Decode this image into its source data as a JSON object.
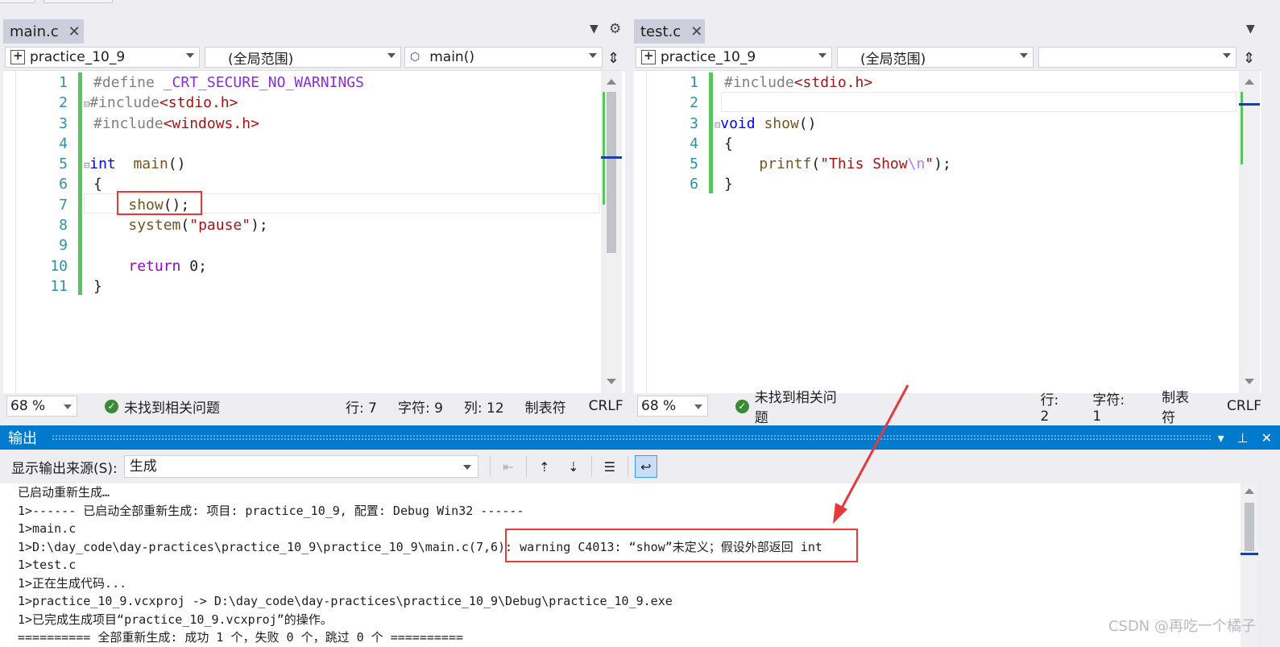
{
  "left_editor": {
    "tab": {
      "label": "main.c",
      "close": "✕"
    },
    "nav": {
      "project": "practice_10_9",
      "scope": "(全局范围)",
      "member": "main()"
    },
    "lines": [
      {
        "n": "1",
        "tokens": [
          [
            "pp",
            "#define "
          ],
          [
            "macro",
            "_CRT_SECURE_NO_WARNINGS"
          ]
        ]
      },
      {
        "n": "2",
        "tokens": [
          [
            "pp",
            "#include"
          ],
          [
            "str",
            "<stdio.h>"
          ]
        ]
      },
      {
        "n": "3",
        "tokens": [
          [
            "pp",
            "#include"
          ],
          [
            "str",
            "<windows.h>"
          ]
        ]
      },
      {
        "n": "4",
        "tokens": []
      },
      {
        "n": "5",
        "tokens": [
          [
            "kw",
            "int"
          ],
          [
            "",
            "  "
          ],
          [
            "fn",
            "main"
          ],
          [
            "",
            "()"
          ]
        ]
      },
      {
        "n": "6",
        "tokens": [
          [
            "",
            "{"
          ]
        ]
      },
      {
        "n": "7",
        "tokens": [
          [
            "",
            "    "
          ],
          [
            "fn",
            "show"
          ],
          [
            "",
            "();"
          ]
        ]
      },
      {
        "n": "8",
        "tokens": [
          [
            "",
            "    "
          ],
          [
            "fn",
            "system"
          ],
          [
            "",
            "("
          ],
          [
            "str",
            "\"pause\""
          ],
          [
            "",
            ");"
          ]
        ]
      },
      {
        "n": "9",
        "tokens": []
      },
      {
        "n": "10",
        "tokens": [
          [
            "",
            "    "
          ],
          [
            "ctrl",
            "return"
          ],
          [
            "",
            " 0;"
          ]
        ]
      },
      {
        "n": "11",
        "tokens": [
          [
            "",
            "}"
          ]
        ]
      }
    ],
    "status": {
      "zoom": "68 %",
      "issues": "未找到相关问题",
      "row": "行: 7",
      "char": "字符: 9",
      "col": "列: 12",
      "tab": "制表符",
      "eol": "CRLF"
    }
  },
  "right_editor": {
    "tab": {
      "label": "test.c",
      "close": "✕"
    },
    "nav": {
      "project": "practice_10_9",
      "scope": "(全局范围)",
      "member": ""
    },
    "lines": [
      {
        "n": "1",
        "tokens": [
          [
            "pp",
            "#include"
          ],
          [
            "str",
            "<stdio.h>"
          ]
        ]
      },
      {
        "n": "2",
        "tokens": []
      },
      {
        "n": "3",
        "tokens": [
          [
            "kw",
            "void"
          ],
          [
            "",
            " "
          ],
          [
            "fn",
            "show"
          ],
          [
            "",
            "()"
          ]
        ]
      },
      {
        "n": "4",
        "tokens": [
          [
            "",
            "{"
          ]
        ]
      },
      {
        "n": "5",
        "tokens": [
          [
            "",
            "    "
          ],
          [
            "fn",
            "printf"
          ],
          [
            "",
            "("
          ],
          [
            "str",
            "\"This Show"
          ],
          [
            "esc",
            "\\n"
          ],
          [
            "str",
            "\""
          ],
          [
            "",
            ");"
          ]
        ]
      },
      {
        "n": "6",
        "tokens": [
          [
            "",
            "}"
          ]
        ]
      }
    ],
    "status": {
      "zoom": "68 %",
      "issues": "未找到相关问题",
      "row": "行: 2",
      "char": "字符: 1",
      "tab": "制表符",
      "eol": "CRLF"
    }
  },
  "output": {
    "title": "输出",
    "source_label": "显示输出来源(S):",
    "source_value": "生成",
    "lines": [
      "已启动重新生成…",
      "1>------ 已启动全部重新生成: 项目: practice_10_9, 配置: Debug Win32 ------",
      "1>main.c",
      "1>D:\\day_code\\day-practices\\practice_10_9\\practice_10_9\\main.c(7,6): warning C4013: “show”未定义；假设外部返回 int",
      "1>test.c",
      "1>正在生成代码...",
      "1>practice_10_9.vcxproj -> D:\\day_code\\day-practices\\practice_10_9\\Debug\\practice_10_9.exe",
      "1>已完成生成项目“practice_10_9.vcxproj”的操作。",
      "========== 全部重新生成: 成功 1 个，失败 0 个，跳过 0 个 =========="
    ]
  },
  "watermark": "CSDN @再吃一个橘子",
  "colors": {
    "accent": "#007acc",
    "highlight_red": "#e63a3a",
    "change_bar": "#57c45f"
  }
}
